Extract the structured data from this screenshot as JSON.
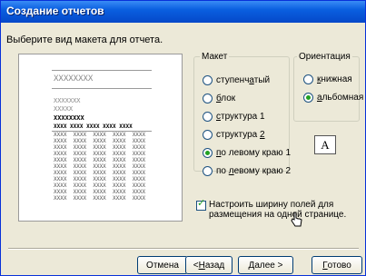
{
  "window": {
    "title": "Создание отчетов"
  },
  "prompt": "Выберите вид макета для отчета.",
  "preview": {
    "header_text": "XXXXXXXX",
    "line1": "XXXXXXX",
    "line2": "XXXXX",
    "bold_line": "XXXXXXXX",
    "table_header": "XXXX XXXX XXXX XXXX XXXX",
    "table_rows": [
      "XXXX  XXXX  XXXX  XXXX  XXXX",
      "XXXX  XXXX  XXXX  XXXX  XXXX",
      "XXXX  XXXX  XXXX  XXXX  XXXX",
      "XXXX  XXXX  XXXX  XXXX  XXXX",
      "XXXX  XXXX  XXXX  XXXX  XXXX",
      "XXXX  XXXX  XXXX  XXXX  XXXX",
      "XXXX  XXXX  XXXX  XXXX  XXXX",
      "XXXX  XXXX  XXXX  XXXX  XXXX",
      "XXXX  XXXX  XXXX  XXXX  XXXX",
      "XXXX  XXXX  XXXX  XXXX  XXXX",
      "XXXX  XXXX  XXXX  XXXX  XXXX"
    ]
  },
  "layout_group": {
    "legend": "Макет",
    "options": [
      {
        "pre": "ступенч",
        "u": "а",
        "post": "тый",
        "selected": false
      },
      {
        "pre": "",
        "u": "б",
        "post": "лок",
        "selected": false
      },
      {
        "pre": "",
        "u": "с",
        "post": "труктура 1",
        "selected": false
      },
      {
        "pre": "структура ",
        "u": "2",
        "post": "",
        "selected": false
      },
      {
        "pre": "",
        "u": "п",
        "post": "о левому краю 1",
        "selected": true
      },
      {
        "pre": "по ",
        "u": "л",
        "post": "евому краю 2",
        "selected": false
      }
    ]
  },
  "orientation_group": {
    "legend": "Ориентация",
    "options": [
      {
        "pre": "",
        "u": "к",
        "post": "нижная",
        "selected": false
      },
      {
        "pre": "",
        "u": "а",
        "post": "льбомная",
        "selected": true
      }
    ],
    "icon_letter": "A"
  },
  "fit_checkbox": {
    "checked": true,
    "label": "Настроить ширину полей для размещения на одной странице."
  },
  "buttons": {
    "cancel": "Отмена",
    "back": "< Назад",
    "next": "Далее >",
    "finish": "Готово"
  }
}
